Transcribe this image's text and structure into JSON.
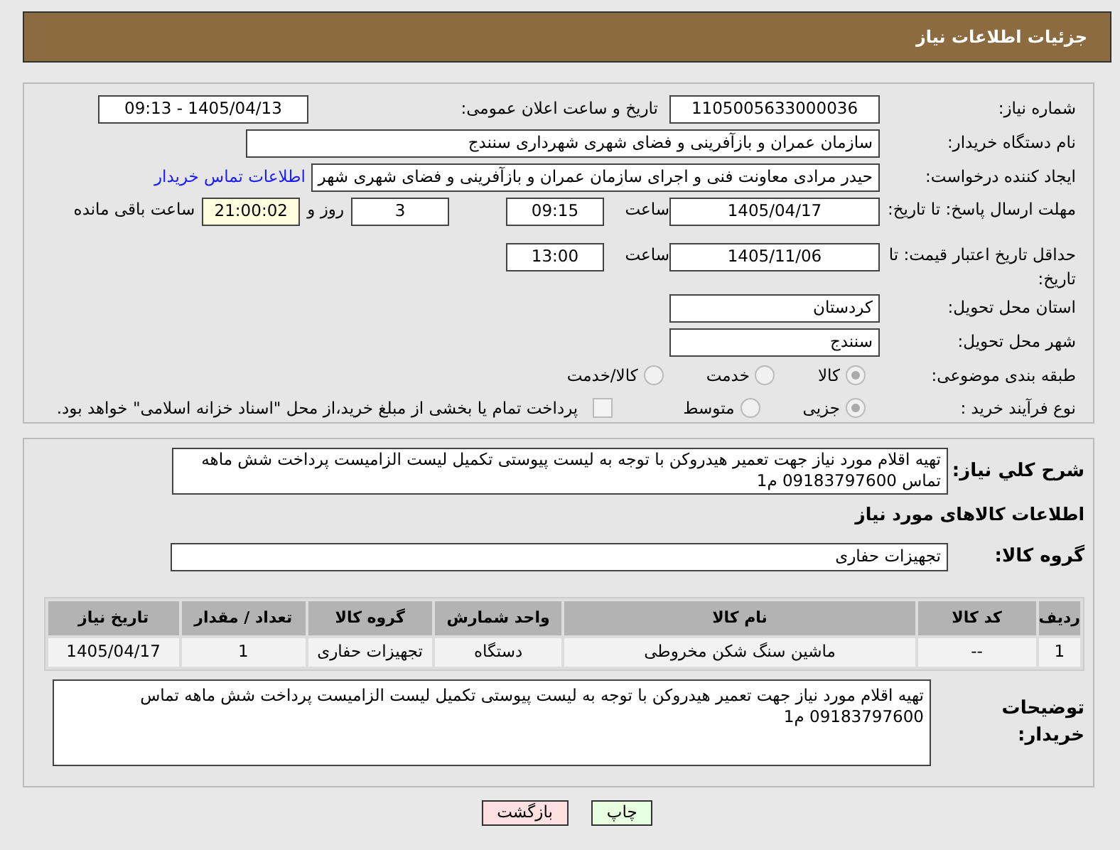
{
  "header": {
    "title": "جزئیات اطلاعات نیاز"
  },
  "need_number": {
    "label": "شماره نیاز:",
    "value": "1105005633000036"
  },
  "announce": {
    "label": "تاریخ و ساعت اعلان عمومی:",
    "value": "1405/04/13 - 09:13"
  },
  "buyer": {
    "label": "نام دستگاه خریدار:",
    "value": "سازمان عمران و بازآفرینی و فضای شهری شهرداری سنندج"
  },
  "creator": {
    "label": "ایجاد کننده درخواست:",
    "value": "حیدر مرادی معاونت فنی و اجرای سازمان عمران و بازآفرینی و فضای شهری شهر",
    "link": "اطلاعات تماس خریدار"
  },
  "deadline": {
    "label": "مهلت ارسال پاسخ: تا تاریخ:",
    "date": "1405/04/17",
    "time_label": "ساعت",
    "time": "09:15",
    "days": "3",
    "days_label": "روز و",
    "remaining": "21:00:02",
    "remaining_label": "ساعت باقی مانده"
  },
  "validity": {
    "label": "حداقل تاریخ اعتبار قیمت: تا تاریخ:",
    "date": "1405/11/06",
    "time_label": "ساعت",
    "time": "13:00"
  },
  "province": {
    "label": "استان محل تحویل:",
    "value": "کردستان"
  },
  "city": {
    "label": "شهر محل تحویل:",
    "value": "سنندج"
  },
  "category": {
    "label": "طبقه بندی موضوعی:",
    "options": [
      {
        "label": "کالا",
        "selected": true
      },
      {
        "label": "خدمت",
        "selected": false
      },
      {
        "label": "کالا/خدمت",
        "selected": false
      }
    ]
  },
  "process": {
    "label": "نوع فرآیند خرید :",
    "options": [
      {
        "label": "جزیی",
        "selected": true
      },
      {
        "label": "متوسط",
        "selected": false
      }
    ],
    "payment": {
      "label": "پرداخت تمام یا بخشی از مبلغ خرید،از محل \"اسناد خزانه اسلامی\" خواهد بود.",
      "checked": false
    }
  },
  "description": {
    "label": "شرح کلي نیاز:",
    "value": "تهیه اقلام مورد نیاز جهت تعمیر هیدروکن با توجه به لیست پیوستی تکمیل لیست الزامیست پرداخت  شش ماهه تماس 09183797600 م1"
  },
  "goods_heading": "اطلاعات کالاهای مورد نیاز",
  "goods_group": {
    "label": "گروه کالا:",
    "value": "تجهیزات حفاری"
  },
  "table": {
    "columns": [
      "ردیف",
      "کد کالا",
      "نام کالا",
      "واحد شمارش",
      "گروه کالا",
      "تعداد / مقدار",
      "تاریخ نیاز"
    ],
    "rows": [
      [
        "1",
        "--",
        "ماشین سنگ شکن مخروطی",
        "دستگاه",
        "تجهیزات حفاری",
        "1",
        "1405/04/17"
      ]
    ]
  },
  "buyer_notes": {
    "label": "توضیحات خریدار:",
    "value": "تهیه اقلام مورد نیاز جهت تعمیر هیدروکن با توجه به لیست پیوستی تکمیل لیست الزامیست پرداخت  شش ماهه تماس 09183797600 م1"
  },
  "buttons": [
    {
      "label": "چاپ",
      "kind": "print"
    },
    {
      "label": "بازگشت",
      "kind": "back"
    }
  ]
}
